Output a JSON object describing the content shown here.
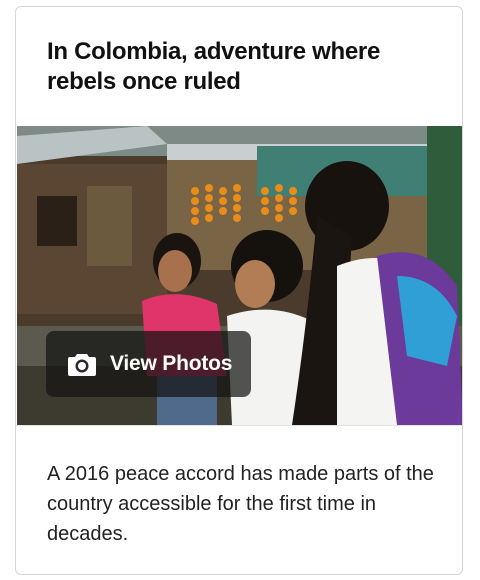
{
  "article": {
    "headline": "In Colombia, adventure where rebels once ruled",
    "photo_button_label": "View Photos",
    "photo_button_icon": "camera-icon",
    "summary": "A 2016 peace accord has made parts of the country accessible for the first time in decades."
  },
  "colors": {
    "card_border": "#d6d6d6",
    "overlay": "#141414",
    "headline_text": "#111111",
    "body_text": "#222222"
  }
}
